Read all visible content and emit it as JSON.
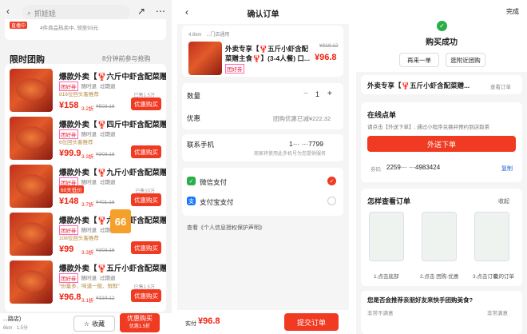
{
  "panel1": {
    "search_placeholder": "抓娃娃",
    "store_note": "4件商品热卖中, 领至93元",
    "store_tag": "直播中",
    "flash_title": "限时团购",
    "viewers": "8分钟前参与抢购",
    "items": [
      {
        "title": "爆款外卖【🦞六斤中虾含配菜赠...",
        "tags": [
          "团好券",
          "随时退",
          "过期退"
        ],
        "sub": "816位回头客推荐",
        "price": "¥158",
        "discount": "3.2折",
        "orig": "¥503.16",
        "sold": "已售1.5万",
        "btn": "优惠购买"
      },
      {
        "title": "爆款外卖【🦞四斤中虾含配菜赠...",
        "tags": [
          "团好券",
          "随时退",
          "过期退"
        ],
        "sub": "6位回头客推荐",
        "price": "¥99.9",
        "discount": "3.3折",
        "orig": "¥303.16",
        "sold": "",
        "btn": "优惠购买"
      },
      {
        "title": "爆款外卖【🦞九斤小虾含配菜赠...",
        "tags": [
          "团好券",
          "随时退",
          "过期退"
        ],
        "sub": "60天低价",
        "price": "¥148",
        "discount": "3.7折",
        "orig": "¥401.16",
        "sold": "已售10万",
        "btn": "优惠购买"
      },
      {
        "title": "爆款外卖【🦞六斤小虾含配菜赠...",
        "tags": [
          "团好券",
          "随时退",
          "过期退"
        ],
        "sub": "108位回头客推荐",
        "price": "¥99",
        "discount": "3.3折",
        "orig": "¥303.16",
        "sold": "",
        "btn": "优惠购买"
      },
      {
        "title": "爆款外卖【🦞五斤小虾含配菜赠...",
        "tags": [
          "团好券",
          "随时退",
          "过期退"
        ],
        "sub": "“份量多、味道一般、鲜鲜”",
        "price": "¥96.8",
        "discount": "3.1折",
        "orig": "¥319.12",
        "sold": "已售1.5万",
        "btn": "优惠购买"
      }
    ],
    "badge66": "66",
    "bottom_store": "...路店)",
    "bottom_dist": "6km · 1.5分",
    "collect": "收藏",
    "buy_main": "优惠购买",
    "buy_sub": "优惠1.5折"
  },
  "panel2": {
    "title": "确认订单",
    "dist": "4.6km",
    "store": "...门店通用",
    "prod_title": "外卖专享【🦞五斤小虾含配菜赠主食🦞】(3-4人餐) 口...",
    "orig_price": "¥319.12",
    "price": "¥96.8",
    "tag": "团好券",
    "qty_label": "数量",
    "qty_value": "1",
    "discount_label": "优惠",
    "discount_value": "团购优惠已减¥222.32",
    "phone_label": "联系手机",
    "phone_value": "1··· ···7799",
    "phone_note": "商家将使用此手机号为您提供服务",
    "wechat": "微信支付",
    "alipay": "支付宝支付",
    "agree": "查看《个人信息授权保护声明》",
    "total_label": "实付",
    "total": "¥96.8",
    "submit": "提交订单"
  },
  "panel3": {
    "done": "完成",
    "success": "购买成功",
    "again": "再来一单",
    "other": "逛附近团购",
    "prod": "外卖专享【🦞五斤小虾含配菜赠...",
    "view_order": "查看订单",
    "online": "在线点单",
    "online_desc": "请点击【外送下单】, 通过小程序兑换并预约到店取茶",
    "deliver": "外送下单",
    "code_label": "券码",
    "code": "2259··· ···4983424",
    "copy": "复制",
    "how": "怎样查看订单",
    "collapse": "收起",
    "steps": [
      "1.点击底部",
      "2.点击 团购·优惠",
      "3.点击订单",
      "我的订单"
    ],
    "recommend": "您是否会推荐亲朋好友来快手团购美食?",
    "rate_low": "非常不满意",
    "rate_high": "非常满意"
  }
}
